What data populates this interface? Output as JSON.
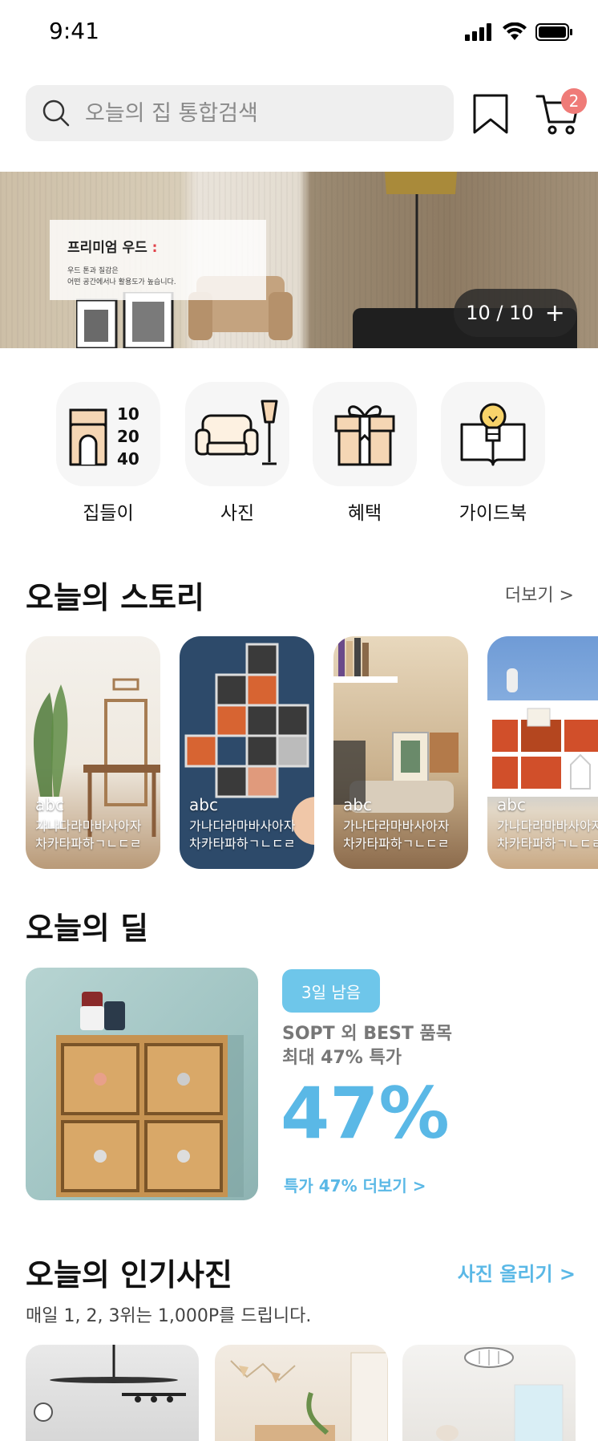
{
  "status_bar": {
    "time": "9:41"
  },
  "header": {
    "search_placeholder": "오늘의 집 통합검색",
    "cart_count": "2"
  },
  "banner": {
    "title": "프리미엄 우드",
    "title_suffix": " :",
    "desc_line1": "우드 톤과 질감은",
    "desc_line2": "어떤 공간에서나 활용도가 높습니다.",
    "counter": "10 / 10",
    "plus": "+"
  },
  "categories": [
    {
      "label": "집들이",
      "icon": "house-icon",
      "numbers": [
        "10",
        "20",
        "40"
      ]
    },
    {
      "label": "사진",
      "icon": "sofa-lamp-icon"
    },
    {
      "label": "혜택",
      "icon": "gift-icon"
    },
    {
      "label": "가이드북",
      "icon": "book-bulb-icon"
    }
  ],
  "story": {
    "title": "오늘의 스토리",
    "more": "더보기 >",
    "cards": [
      {
        "tag": "abc",
        "line1": "가나다라마바사아자",
        "line2": "차카타파하ㄱㄴㄷㄹ"
      },
      {
        "tag": "abc",
        "line1": "가나다라마바사아자",
        "line2": "차카타파하ㄱㄴㄷㄹ"
      },
      {
        "tag": "abc",
        "line1": "가나다라마바사아자",
        "line2": "차카타파하ㄱㄴㄷㄹ"
      },
      {
        "tag": "abc",
        "line1": "가나다라마바사아자",
        "line2": "차카타파하ㄱㄴㄷㄹ"
      }
    ]
  },
  "deal": {
    "title": "오늘의 딜",
    "badge": "3일 남음",
    "desc_line1": "SOPT 외 BEST 품목",
    "desc_line2": "최대 47% 특가",
    "percent": "47%",
    "more": "특가 47% 더보기 >"
  },
  "popular": {
    "title": "오늘의 인기사진",
    "upload": "사진 올리기 >",
    "subtitle": "매일 1, 2, 3위는 1,000P를 드립니다."
  },
  "colors": {
    "accent": "#5ab8e6",
    "badge": "#ef7b78"
  }
}
